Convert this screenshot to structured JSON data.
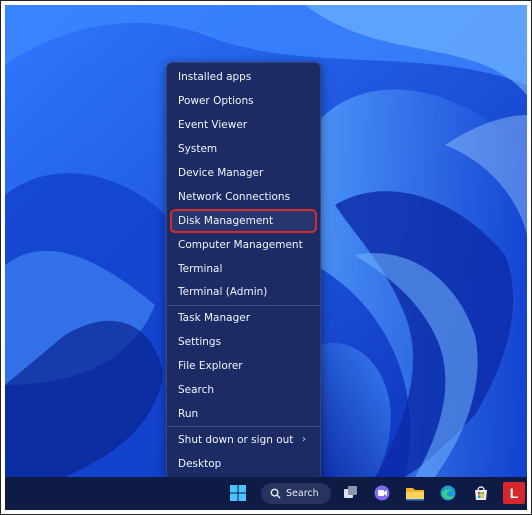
{
  "menu": {
    "items": [
      {
        "label": "Installed apps"
      },
      {
        "label": "Power Options"
      },
      {
        "label": "Event Viewer"
      },
      {
        "label": "System"
      },
      {
        "label": "Device Manager"
      },
      {
        "label": "Network Connections"
      },
      {
        "label": "Disk Management"
      },
      {
        "label": "Computer Management"
      },
      {
        "label": "Terminal"
      },
      {
        "label": "Terminal (Admin)"
      },
      {
        "label": "Task Manager"
      },
      {
        "label": "Settings"
      },
      {
        "label": "File Explorer"
      },
      {
        "label": "Search"
      },
      {
        "label": "Run"
      },
      {
        "label": "Shut down or sign out",
        "submenu_arrow": "›"
      },
      {
        "label": "Desktop"
      }
    ],
    "highlighted": "Disk Management",
    "highlight_color": "#d42a2a"
  },
  "taskbar": {
    "search_label": "Search",
    "icons": [
      "windows-start-icon",
      "search-icon",
      "task-view-icon",
      "chat-icon",
      "file-explorer-icon",
      "edge-icon",
      "store-icon",
      "app-l-icon"
    ],
    "app_l_letter": "L"
  },
  "colors": {
    "menu_bg": "#1c2b63",
    "taskbar_bg": "#0e1c45",
    "wallpaper": "#1a56e8"
  }
}
